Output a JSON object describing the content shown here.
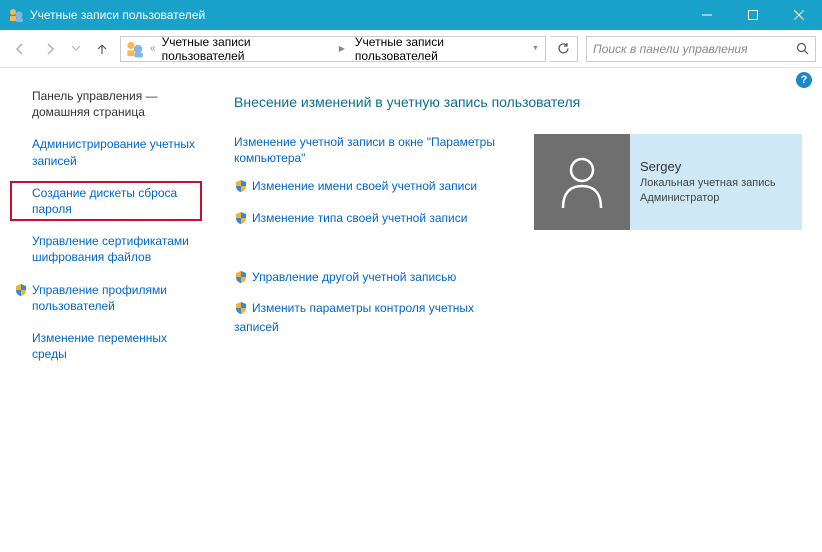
{
  "window": {
    "title": "Учетные записи пользователей"
  },
  "breadcrumb": {
    "prefix": "«",
    "seg1": "Учетные записи пользователей",
    "seg2": "Учетные записи пользователей"
  },
  "search": {
    "placeholder": "Поиск в панели управления"
  },
  "sidebar": {
    "items": [
      {
        "label": "Панель управления — домашняя страница",
        "link": false,
        "shield": false,
        "hl": false
      },
      {
        "label": "Администрирование учетных записей",
        "link": true,
        "shield": false,
        "hl": false
      },
      {
        "label": "Создание дискеты сброса пароля",
        "link": true,
        "shield": false,
        "hl": true
      },
      {
        "label": "Управление сертификатами шифрования файлов",
        "link": true,
        "shield": false,
        "hl": false
      },
      {
        "label": "Управление профилями пользователей",
        "link": true,
        "shield": true,
        "hl": false
      },
      {
        "label": "Изменение переменных среды",
        "link": true,
        "shield": false,
        "hl": false
      }
    ]
  },
  "main": {
    "heading": "Внесение изменений в учетную запись пользователя",
    "group1": [
      {
        "label": "Изменение учетной записи в окне \"Параметры компьютера\"",
        "shield": false
      },
      {
        "label": "Изменение имени своей учетной записи",
        "shield": true
      },
      {
        "label": "Изменение типа своей учетной записи",
        "shield": true
      }
    ],
    "group2": [
      {
        "label": "Управление другой учетной записью",
        "shield": true
      },
      {
        "label": "Изменить параметры контроля учетных записей",
        "shield": true
      }
    ]
  },
  "user": {
    "name": "Sergey",
    "role1": "Локальная учетная запись",
    "role2": "Администратор"
  }
}
